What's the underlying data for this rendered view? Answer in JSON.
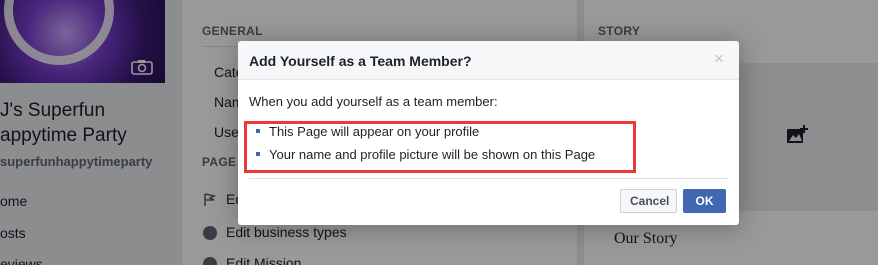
{
  "background": {
    "page_name": "J's Superfun Happytime Party",
    "page_name_line1": "J's Superfun",
    "page_name_line2": "appytime Party",
    "page_handle": "superfunhappytimeparty",
    "nav": [
      "ome",
      "osts",
      "eviews"
    ],
    "general_title": "GENERAL",
    "general_rows": [
      "Cate",
      "Nam",
      "Use"
    ],
    "page_section_title": "PAGE",
    "page_rows": [
      "Ed",
      "Edit business types",
      "Edit Mission"
    ],
    "story_title": "STORY",
    "our_story": "Our Story"
  },
  "dialog": {
    "title": "Add Yourself as a Team Member?",
    "close_symbol": "×",
    "intro": "When you add yourself as a team member:",
    "bullets": [
      "This Page will appear on your profile",
      "Your name and profile picture will be shown on this Page"
    ],
    "cancel_label": "Cancel",
    "ok_label": "OK"
  },
  "colors": {
    "accent": "#4267b2",
    "highlight": "#e83a3e",
    "overlay": "rgba(0,0,0,0.4)"
  },
  "icons": [
    "camera-icon",
    "flag-icon",
    "info-icon",
    "mission-icon",
    "add-photo-icon",
    "close-icon"
  ]
}
